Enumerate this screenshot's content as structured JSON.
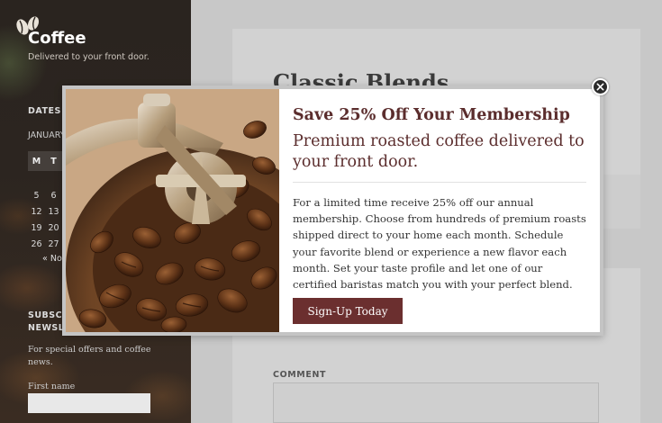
{
  "site": {
    "title": "Coffee",
    "tagline": "Delivered to your front door."
  },
  "sidebar": {
    "dates_title": "DATES",
    "month": "JANUARY",
    "calendar_headers": [
      "M",
      "T"
    ],
    "calendar_rows": [
      [
        "5",
        "6"
      ],
      [
        "12",
        "13"
      ],
      [
        "19",
        "20"
      ],
      [
        "26",
        "27"
      ]
    ],
    "prev_link": "« Nov",
    "subscribe_title_line1": "SUBSCRIBE",
    "subscribe_title_line2": "NEWSLETTER",
    "subscribe_text": "For special offers and coffee news.",
    "first_name_label": "First name"
  },
  "main": {
    "post_title": "Classic Blends",
    "comment_label": "COMMENT"
  },
  "modal": {
    "headline": "Save 25% Off Your Membership",
    "subheadline": "Premium roasted coffee delivered to your front door.",
    "body": "For a limited time receive 25% off our annual membership. Choose from hundreds of premium roasts shipped direct to your home each month. Schedule your favorite blend or experience a new flavor each month. Set your taste profile and let one of our certified baristas match you with your perfect blend.",
    "button_label": "Sign-Up Today",
    "close_icon": "close-icon"
  },
  "colors": {
    "accent": "#6b2f2f",
    "headline": "#5b2d2d"
  }
}
